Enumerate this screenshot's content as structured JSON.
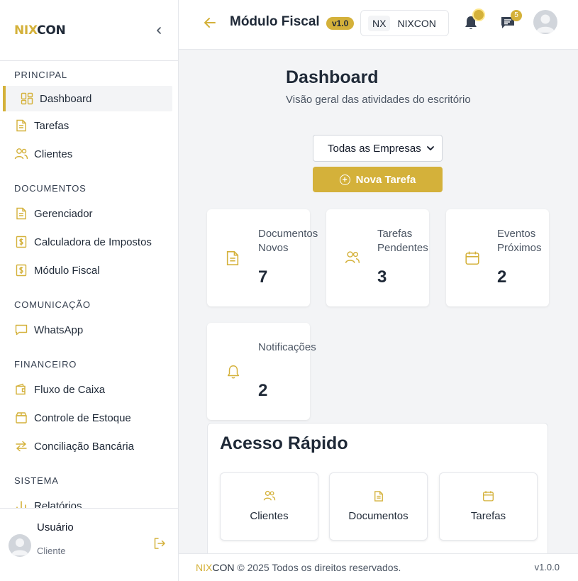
{
  "brand": {
    "part1": "NIX",
    "part2": "CON"
  },
  "sidebar": {
    "sections": [
      {
        "title": "PRINCIPAL",
        "items": [
          {
            "label": "Dashboard",
            "icon": "grid-icon"
          },
          {
            "label": "Tarefas",
            "icon": "document-icon"
          },
          {
            "label": "Clientes",
            "icon": "users-icon"
          }
        ]
      },
      {
        "title": "DOCUMENTOS",
        "items": [
          {
            "label": "Gerenciador",
            "icon": "document-icon"
          },
          {
            "label": "Calculadora de Impostos",
            "icon": "dollar-doc-icon"
          },
          {
            "label": "Módulo Fiscal",
            "icon": "dollar-doc-icon"
          }
        ]
      },
      {
        "title": "COMUNICAÇÃO",
        "items": [
          {
            "label": "WhatsApp",
            "icon": "message-icon"
          }
        ]
      },
      {
        "title": "FINANCEIRO",
        "items": [
          {
            "label": "Fluxo de Caixa",
            "icon": "wallet-icon"
          },
          {
            "label": "Controle de Estoque",
            "icon": "box-icon"
          },
          {
            "label": "Conciliação Bancária",
            "icon": "exchange-icon"
          }
        ]
      },
      {
        "title": "SISTEMA",
        "items": [
          {
            "label": "Relatórios",
            "icon": "bar-chart-icon"
          }
        ]
      }
    ],
    "user": {
      "name": "Usuário",
      "role": "Cliente"
    }
  },
  "header": {
    "title": "Módulo Fiscal",
    "version": "v1.0",
    "company_initials": "NX",
    "company_name": "NIXCON",
    "chat_count": "5"
  },
  "main": {
    "title": "Dashboard",
    "subtitle": "Visão geral das atividades do escritório",
    "select_value": "Todas as Empresas",
    "new_task_label": "Nova Tarefa",
    "stats": [
      {
        "label": "Documentos Novos",
        "value": "7",
        "icon": "document-icon"
      },
      {
        "label": "Tarefas Pendentes",
        "value": "3",
        "icon": "users-icon"
      },
      {
        "label": "Eventos Próximos",
        "value": "2",
        "icon": "calendar-icon"
      },
      {
        "label": "Notificações",
        "value": "2",
        "icon": "bell-icon"
      }
    ],
    "quick_access": {
      "title": "Acesso Rápido",
      "items": [
        {
          "label": "Clientes",
          "icon": "users-icon"
        },
        {
          "label": "Documentos",
          "icon": "document-icon"
        },
        {
          "label": "Tarefas",
          "icon": "calendar-icon"
        }
      ]
    }
  },
  "footer": {
    "brand1": "NIX",
    "brand2": "CON",
    "copyright": " © 2025 Todos os direitos reservados.",
    "version": "v1.0.0"
  },
  "colors": {
    "accent": "#d4b13a",
    "text": "#1f2937",
    "background": "#f3f4f6"
  }
}
